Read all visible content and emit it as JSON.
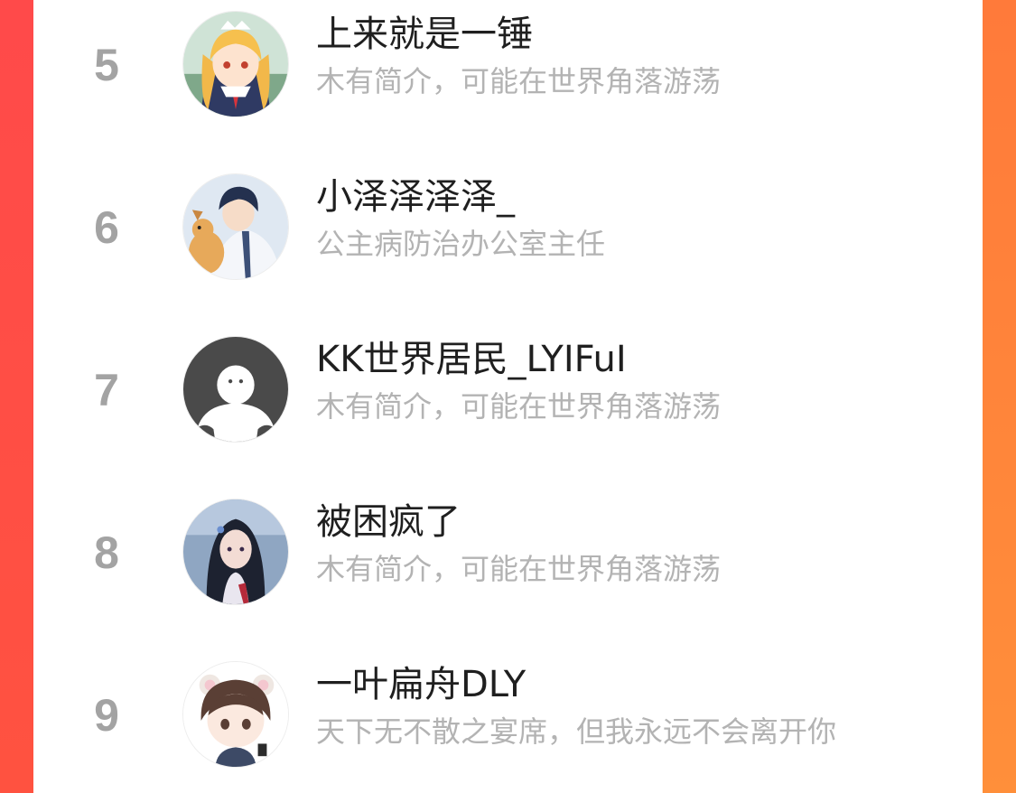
{
  "colors": {
    "frame_left": "#ff4a4a",
    "frame_right": "#ff8a3a",
    "rank_text": "#a3a3a3",
    "name_text": "#1f1f1f",
    "bio_text": "#b3b3b3"
  },
  "ranking": {
    "items": [
      {
        "rank": "5",
        "name": "上来就是一锤",
        "bio": "木有简介，可能在世界角落游荡",
        "avatar_icon": "anime-girl-blonde-maid-avatar"
      },
      {
        "rank": "6",
        "name": "小泽泽泽泽_",
        "bio": "公主病防治办公室主任",
        "avatar_icon": "anime-boy-with-dog-avatar"
      },
      {
        "rank": "7",
        "name": "KK世界居民_LYIFuI",
        "bio": "木有简介，可能在世界角落游荡",
        "avatar_icon": "default-user-silhouette-avatar"
      },
      {
        "rank": "8",
        "name": "被困疯了",
        "bio": "木有简介，可能在世界角落游荡",
        "avatar_icon": "anime-girl-dark-hair-avatar"
      },
      {
        "rank": "9",
        "name": "一叶扁舟DLY",
        "bio": "天下无不散之宴席，但我永远不会离开你",
        "avatar_icon": "chibi-child-mouse-ears-avatar"
      }
    ]
  }
}
